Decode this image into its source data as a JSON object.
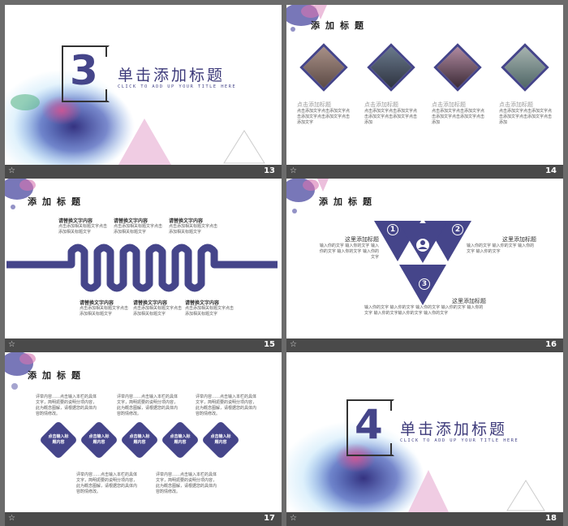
{
  "slides": {
    "s13": {
      "number": "13",
      "digit": "3",
      "title": "单击添加标题",
      "subtitle": "CLICK TO ADD UP YOUR TITLE HERE"
    },
    "s14": {
      "number": "14",
      "header": "添加标题",
      "items": [
        {
          "title": "点击添加标题",
          "body": "点击添加文字点击添加文字点击添加文字点击添加文字点击添加文字"
        },
        {
          "title": "点击添加标题",
          "body": "点击添加文字点击添加文字点击添加文字点击添加文字点击添加"
        },
        {
          "title": "点击添加标题",
          "body": "点击添加文字点击添加文字点击添加文字点击添加文字点击添加"
        },
        {
          "title": "点击添加标题",
          "body": "点击添加文字点击添加文字点击添加文字点击添加文字点击添加"
        }
      ]
    },
    "s15": {
      "number": "15",
      "header": "添加标题",
      "top": [
        {
          "title": "请替换文字内容",
          "body": "点击添加相关标题文字点击添加相关标题文字"
        },
        {
          "title": "请替换文字内容",
          "body": "点击添加相关标题文字点击添加相关标题文字"
        },
        {
          "title": "请替换文字内容",
          "body": "点击添加相关标题文字点击添加相关标题文字"
        }
      ],
      "bottom": [
        {
          "title": "请替换文字内容",
          "body": "点击添加相关标题文字点击添加相关标题文字"
        },
        {
          "title": "请替换文字内容",
          "body": "点击添加相关标题文字点击添加相关标题文字"
        },
        {
          "title": "请替换文字内容",
          "body": "点击添加相关标题文字点击添加相关标题文字"
        }
      ]
    },
    "s16": {
      "number": "16",
      "header": "添加标题",
      "left_title": "这里添加标题",
      "left_body": "输入你的文字 输入你的文字 输入你的文字 输入你的文字 输入你的文字",
      "right_title": "这里添加标题",
      "right_body": "输入你的文字 输入你的文字 输入你的文字 输入你的文字",
      "bottom_title": "这里添加标题",
      "bottom_body": "输入你的文字 输入你的文字 输入你的文字 输入你的文字 输入你的文字 输入你的文字输入你的文字 输入你的文字",
      "badges": [
        "1",
        "2",
        "3"
      ]
    },
    "s17": {
      "number": "17",
      "header": "添加标题",
      "top_texts": [
        "评举内容……点击输入本栏的具体文字，简明扼要的说明分项内容，此为概念图解，请根据您的具体内容酌情修改。",
        "评举内容……点击输入本栏的具体文字，简明扼要的说明分项内容，此为概念图解，请根据您的具体内容酌情修改。",
        "评举内容……点击输入本栏的具体文字，简明扼要的说明分项内容，此为概念图解，请根据您的具体内容酌情修改。"
      ],
      "bottom_texts": [
        "评举内容……点击输入本栏的具体文字，简明扼要的说明分项内容，此为概念图解，请根据您的具体内容酌情修改。",
        "评举内容……点击输入本栏的具体文字，简明扼要的说明分项内容，此为概念图解，请根据您的具体内容酌情修改。"
      ],
      "diamonds": [
        "点击输入标题内容",
        "点击输入标题内容",
        "点击输入标题内容",
        "点击输入标题内容",
        "点击输入标题内容"
      ]
    },
    "s18": {
      "number": "18",
      "digit": "4",
      "title": "单击添加标题",
      "subtitle": "CLICK TO ADD UP YOUR TITLE HERE"
    }
  },
  "colors": {
    "accent": "#45458a",
    "pink": "#e9b8d6"
  }
}
